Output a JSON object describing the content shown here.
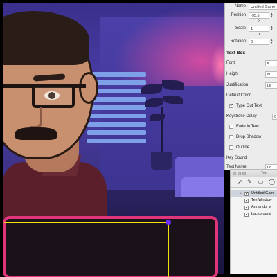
{
  "inspector": {
    "name_label": "Name",
    "name_value": "Untitled Game",
    "position_label": "Position",
    "position_value": "-95.5",
    "position_axis": "X",
    "scale_label": "Scale",
    "scale_value": "1",
    "scale_axis": "X",
    "rotation_label": "Rotation",
    "rotation_value": "0",
    "textbox_section": "Text Box",
    "font_label": "Font",
    "font_value": "K",
    "height_label": "Height",
    "height_value": "N",
    "justification_label": "Justification",
    "justification_value": "Le",
    "default_color_label": "Default Color",
    "type_out_label": "Type Out Text",
    "type_out_checked": true,
    "keystroke_delay_label": "Keystroke Delay",
    "keystroke_delay_value": "0",
    "fade_in_label": "Fade In Text",
    "drop_shadow_label": "Drop Shadow",
    "outline_label": "Outline",
    "key_sound_label": "Key Sound",
    "text_name_label": "Text Name",
    "text_name_value": "Lo"
  },
  "layers_panel": {
    "title": "Text",
    "items": [
      {
        "label": "Untitled Gam",
        "checked": true,
        "selected": true
      },
      {
        "label": "TextWindow",
        "checked": true,
        "selected": false
      },
      {
        "label": "Armando_v",
        "checked": true,
        "selected": false
      },
      {
        "label": "background",
        "checked": true,
        "selected": false
      }
    ]
  },
  "icons": {
    "pointer": "arrow-pointer-icon",
    "pen": "pen-icon",
    "image": "image-icon",
    "zoom": "zoom-icon"
  },
  "colors": {
    "textbox_border": "#e0357a",
    "selection": "#f1e20e",
    "selection_handle": "#6a2cff"
  }
}
